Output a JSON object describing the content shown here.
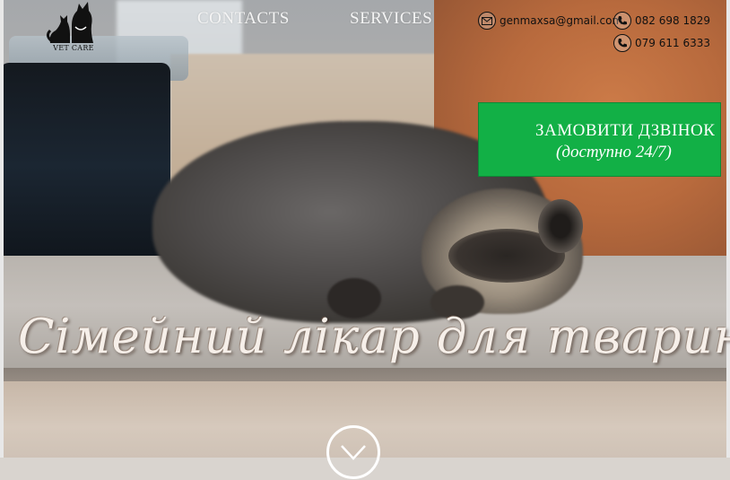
{
  "logo": {
    "text": "VET CARE",
    "icon": "cat-dog-silhouette-icon"
  },
  "nav": {
    "contacts": "CONTACTS",
    "services": "SERVICES"
  },
  "contacts": {
    "email": "genmaxsa@gmail.com",
    "phone1": "082 698 1829",
    "phone2": "079 611 6333"
  },
  "call_button": {
    "label": "ЗАМОВИТИ ДЗВІНОК",
    "sublabel": "(доступно 24/7)",
    "color": "#12b046"
  },
  "hero": {
    "headline": "Сімейний лікар для тварин",
    "scroll_icon": "chevron-down-icon"
  }
}
